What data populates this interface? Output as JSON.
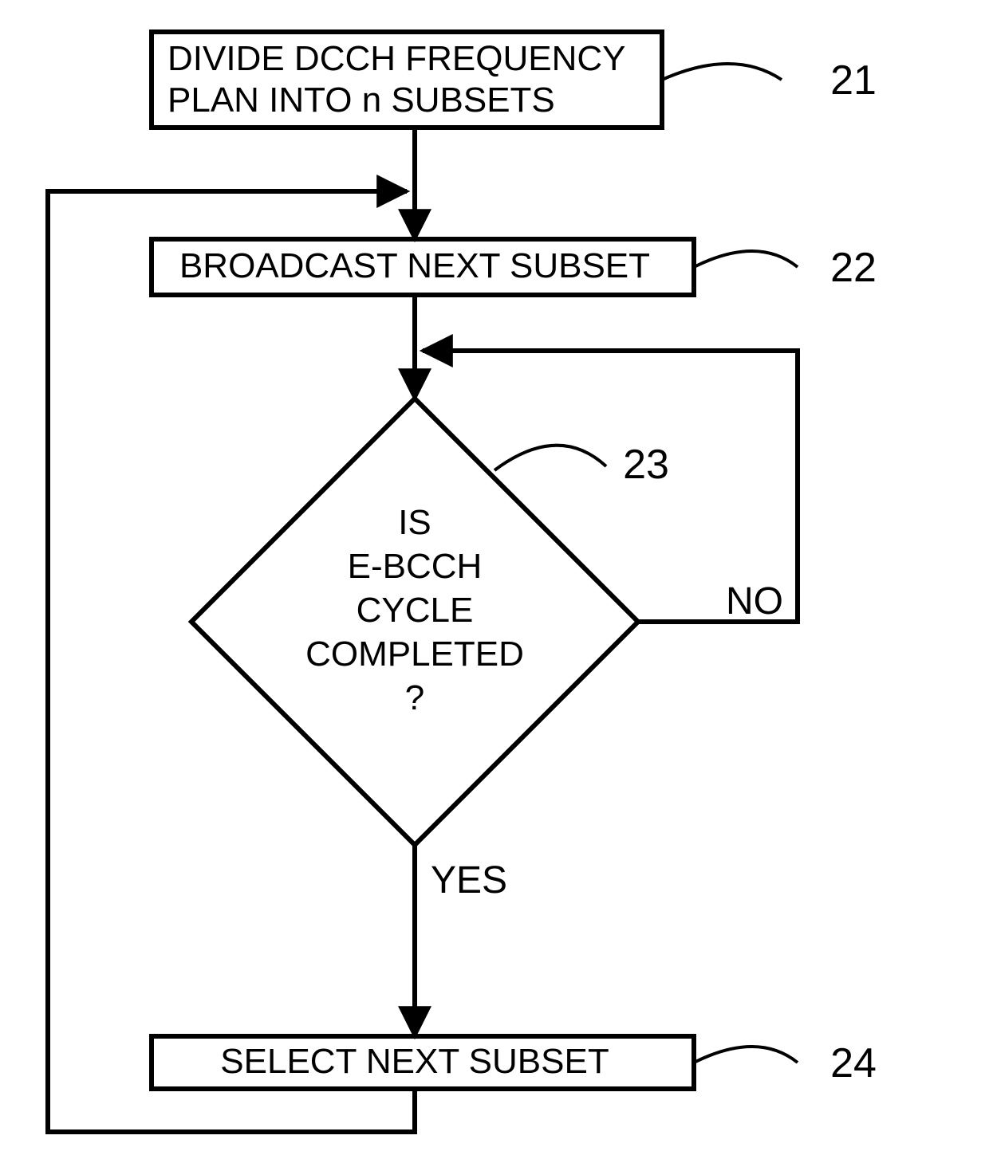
{
  "nodes": {
    "n21": {
      "line1": "DIVIDE DCCH FREQUENCY",
      "line2": "PLAN INTO n SUBSETS",
      "ref": "21"
    },
    "n22": {
      "line1": "BROADCAST NEXT SUBSET",
      "ref": "22"
    },
    "n23": {
      "l1": "IS",
      "l2": "E-BCCH",
      "l3": "CYCLE",
      "l4": "COMPLETED",
      "l5": "?",
      "ref": "23"
    },
    "n24": {
      "line1": "SELECT  NEXT SUBSET",
      "ref": "24"
    }
  },
  "edges": {
    "yes": "YES",
    "no": "NO"
  }
}
